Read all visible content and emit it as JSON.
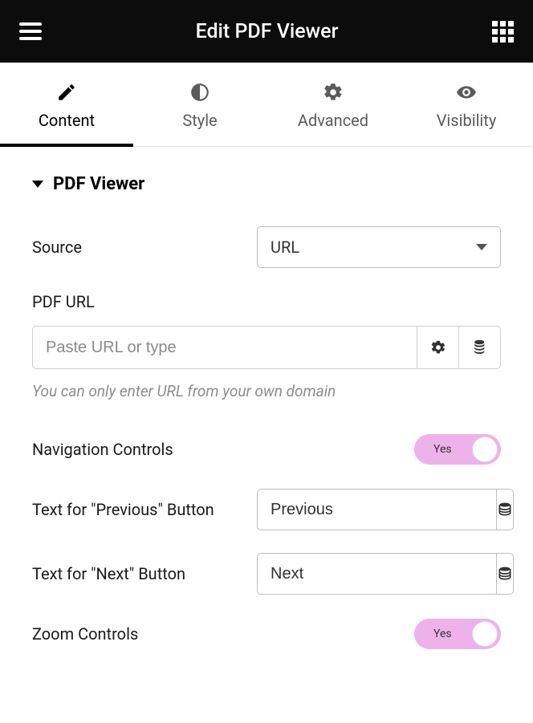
{
  "header": {
    "title": "Edit PDF Viewer"
  },
  "tabs": [
    {
      "label": "Content"
    },
    {
      "label": "Style"
    },
    {
      "label": "Advanced"
    },
    {
      "label": "Visibility"
    }
  ],
  "section": {
    "title": "PDF Viewer"
  },
  "fields": {
    "source": {
      "label": "Source",
      "value": "URL"
    },
    "pdf_url": {
      "label": "PDF URL",
      "placeholder": "Paste URL or type",
      "helper": "You can only enter URL from your own domain"
    },
    "nav_controls": {
      "label": "Navigation Controls",
      "value": "Yes"
    },
    "prev_text": {
      "label": "Text for \"Previous\" Button",
      "value": "Previous"
    },
    "next_text": {
      "label": "Text for \"Next\" Button",
      "value": "Next"
    },
    "zoom_controls": {
      "label": "Zoom Controls",
      "value": "Yes"
    }
  }
}
